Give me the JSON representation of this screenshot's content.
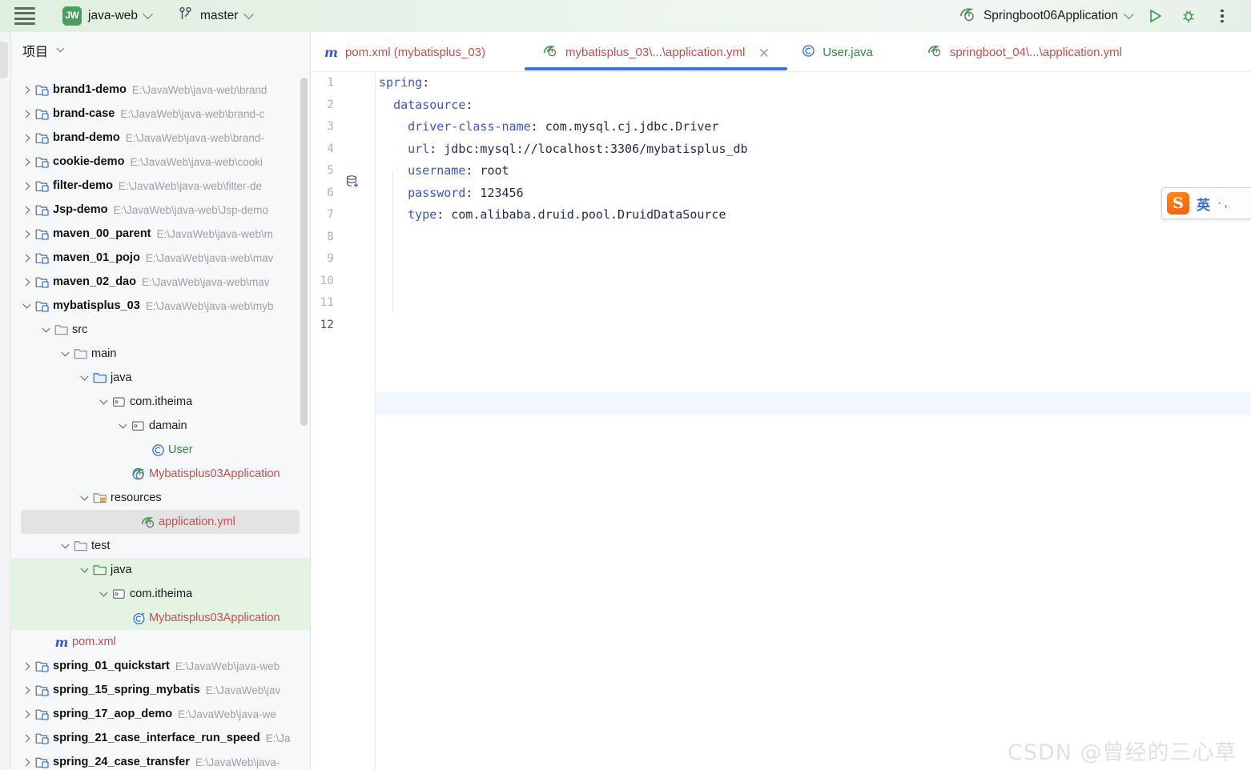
{
  "topbar": {
    "hamburger_icon": "hamburger-menu-icon",
    "project_badge": "JW",
    "project_name": "java-web",
    "branch_icon": "git-branch-icon",
    "branch_name": "master",
    "run_config_icon": "spring-boot-icon",
    "run_config_name": "Springboot06Application",
    "run_icon": "run-play-icon",
    "debug_icon": "debug-bug-icon",
    "more_icon": "more-vertical-icon"
  },
  "project_panel": {
    "title": "项目",
    "collapse_icon": "chevron-down-icon",
    "tree": [
      {
        "depth": 0,
        "arrow": "right",
        "icon": "module-folder-icon",
        "name": "brand1-demo",
        "kind": "module",
        "path": "E:\\JavaWeb\\java-web\\brand"
      },
      {
        "depth": 0,
        "arrow": "right",
        "icon": "module-folder-icon",
        "name": "brand-case",
        "kind": "module",
        "path": "E:\\JavaWeb\\java-web\\brand-c"
      },
      {
        "depth": 0,
        "arrow": "right",
        "icon": "module-folder-icon",
        "name": "brand-demo",
        "kind": "module",
        "path": "E:\\JavaWeb\\java-web\\brand-"
      },
      {
        "depth": 0,
        "arrow": "right",
        "icon": "module-folder-icon",
        "name": "cookie-demo",
        "kind": "module",
        "path": "E:\\JavaWeb\\java-web\\cooki"
      },
      {
        "depth": 0,
        "arrow": "right",
        "icon": "module-folder-icon",
        "name": "filter-demo",
        "kind": "module",
        "path": "E:\\JavaWeb\\java-web\\filter-de"
      },
      {
        "depth": 0,
        "arrow": "right",
        "icon": "module-folder-icon",
        "name": "Jsp-demo",
        "kind": "module",
        "path": "E:\\JavaWeb\\java-web\\Jsp-demo"
      },
      {
        "depth": 0,
        "arrow": "right",
        "icon": "module-folder-icon",
        "name": "maven_00_parent",
        "kind": "module",
        "path": "E:\\JavaWeb\\java-web\\m"
      },
      {
        "depth": 0,
        "arrow": "right",
        "icon": "module-folder-icon",
        "name": "maven_01_pojo",
        "kind": "module",
        "path": "E:\\JavaWeb\\java-web\\mav"
      },
      {
        "depth": 0,
        "arrow": "right",
        "icon": "module-folder-icon",
        "name": "maven_02_dao",
        "kind": "module",
        "path": "E:\\JavaWeb\\java-web\\mav"
      },
      {
        "depth": 0,
        "arrow": "down",
        "icon": "module-folder-icon",
        "name": "mybatisplus_03",
        "kind": "module",
        "path": "E:\\JavaWeb\\java-web\\myb"
      },
      {
        "depth": 1,
        "arrow": "down",
        "icon": "folder-icon",
        "name": "src",
        "kind": "plain",
        "path": ""
      },
      {
        "depth": 2,
        "arrow": "down",
        "icon": "folder-icon",
        "name": "main",
        "kind": "plain",
        "path": ""
      },
      {
        "depth": 3,
        "arrow": "down",
        "icon": "source-folder-icon",
        "name": "java",
        "kind": "plain",
        "path": ""
      },
      {
        "depth": 4,
        "arrow": "down",
        "icon": "package-icon",
        "name": "com.itheima",
        "kind": "plain",
        "path": ""
      },
      {
        "depth": 5,
        "arrow": "down",
        "icon": "package-icon",
        "name": "damain",
        "kind": "plain",
        "path": ""
      },
      {
        "depth": 6,
        "arrow": "none",
        "icon": "java-class-icon",
        "name": "User",
        "kind": "green",
        "path": ""
      },
      {
        "depth": 5,
        "arrow": "none",
        "icon": "spring-boot-class-icon",
        "name": "Mybatisplus03Application",
        "kind": "red",
        "path": ""
      },
      {
        "depth": 3,
        "arrow": "down",
        "icon": "resources-folder-icon",
        "name": "resources",
        "kind": "plain",
        "path": ""
      },
      {
        "depth": 5,
        "arrow": "none",
        "icon": "spring-yaml-icon",
        "name": "application.yml",
        "kind": "red",
        "path": "",
        "selected": true
      },
      {
        "depth": 2,
        "arrow": "down",
        "icon": "folder-icon",
        "name": "test",
        "kind": "plain",
        "path": ""
      },
      {
        "depth": 3,
        "arrow": "down",
        "icon": "test-source-folder-icon",
        "name": "java",
        "kind": "plain",
        "path": "",
        "green_band": true
      },
      {
        "depth": 4,
        "arrow": "down",
        "icon": "package-icon",
        "name": "com.itheima",
        "kind": "plain",
        "path": "",
        "green_band": true
      },
      {
        "depth": 5,
        "arrow": "none",
        "icon": "test-class-icon",
        "name": "Mybatisplus03Application",
        "kind": "red",
        "path": "",
        "green_band": true
      },
      {
        "depth": 1,
        "arrow": "none",
        "icon": "maven-pom-icon",
        "name": "pom.xml",
        "kind": "red",
        "path": ""
      },
      {
        "depth": 0,
        "arrow": "right",
        "icon": "module-folder-icon",
        "name": "spring_01_quickstart",
        "kind": "module",
        "path": "E:\\JavaWeb\\java-web"
      },
      {
        "depth": 0,
        "arrow": "right",
        "icon": "module-folder-icon",
        "name": "spring_15_spring_mybatis",
        "kind": "module",
        "path": "E:\\JavaWeb\\jav"
      },
      {
        "depth": 0,
        "arrow": "right",
        "icon": "module-folder-icon",
        "name": "spring_17_aop_demo",
        "kind": "module",
        "path": "E:\\JavaWeb\\java-we"
      },
      {
        "depth": 0,
        "arrow": "right",
        "icon": "module-folder-icon",
        "name": "spring_21_case_interface_run_speed",
        "kind": "module",
        "path": "E:\\Ja"
      },
      {
        "depth": 0,
        "arrow": "right",
        "icon": "module-folder-icon",
        "name": "spring_24_case_transfer",
        "kind": "module",
        "path": "E:\\JavaWeb\\java-"
      }
    ]
  },
  "editor": {
    "tabs": [
      {
        "icon": "maven-pom-icon",
        "label": "pom.xml (mybatisplus_03)",
        "color": "red",
        "active": false,
        "closable": false
      },
      {
        "icon": "spring-yaml-icon",
        "label": "mybatisplus_03\\...\\application.yml",
        "color": "red",
        "active": true,
        "closable": true
      },
      {
        "icon": "java-class-icon",
        "label": "User.java",
        "color": "green",
        "active": false,
        "closable": false
      },
      {
        "icon": "spring-yaml-icon",
        "label": "springboot_04\\...\\application.yml",
        "color": "red",
        "active": false,
        "closable": false
      }
    ],
    "active_tab_accent": "#3574F0",
    "gutter_icon": "database-add-icon",
    "current_line": 12,
    "line_numbers": [
      "1",
      "2",
      "3",
      "4",
      "5",
      "6",
      "7",
      "8",
      "9",
      "10",
      "11",
      "12"
    ],
    "lines": [
      {
        "n": 1,
        "indent": 0,
        "key": "spring",
        "sep": ":",
        "value": ""
      },
      {
        "n": 2,
        "indent": 2,
        "key": "datasource",
        "sep": ":",
        "value": ""
      },
      {
        "n": 3,
        "indent": 4,
        "key": "driver-class-name",
        "sep": ":",
        "value": " com.mysql.cj.jdbc.Driver"
      },
      {
        "n": 4,
        "indent": 4,
        "key": "url",
        "sep": ":",
        "value": " jdbc:mysql://localhost:3306/mybatisplus_db"
      },
      {
        "n": 5,
        "indent": 4,
        "key": "username",
        "sep": ":",
        "value": " root"
      },
      {
        "n": 6,
        "indent": 4,
        "key": "password",
        "sep": ":",
        "value": " 123456"
      },
      {
        "n": 7,
        "indent": 4,
        "key": "type",
        "sep": ":",
        "value": " com.alibaba.druid.pool.DruidDataSource"
      },
      {
        "n": 8,
        "indent": 0,
        "key": "",
        "sep": "",
        "value": ""
      },
      {
        "n": 9,
        "indent": 0,
        "key": "",
        "sep": "",
        "value": ""
      },
      {
        "n": 10,
        "indent": 0,
        "key": "",
        "sep": "",
        "value": ""
      },
      {
        "n": 11,
        "indent": 0,
        "key": "",
        "sep": "",
        "value": ""
      },
      {
        "n": 12,
        "indent": 0,
        "key": "",
        "sep": "",
        "value": ""
      }
    ]
  },
  "ime": {
    "logo_icon": "sogou-logo-icon",
    "logo_text": "S",
    "mode": "英",
    "dots": "·,"
  },
  "watermark": {
    "text": "CSDN @曾经的三心草"
  }
}
